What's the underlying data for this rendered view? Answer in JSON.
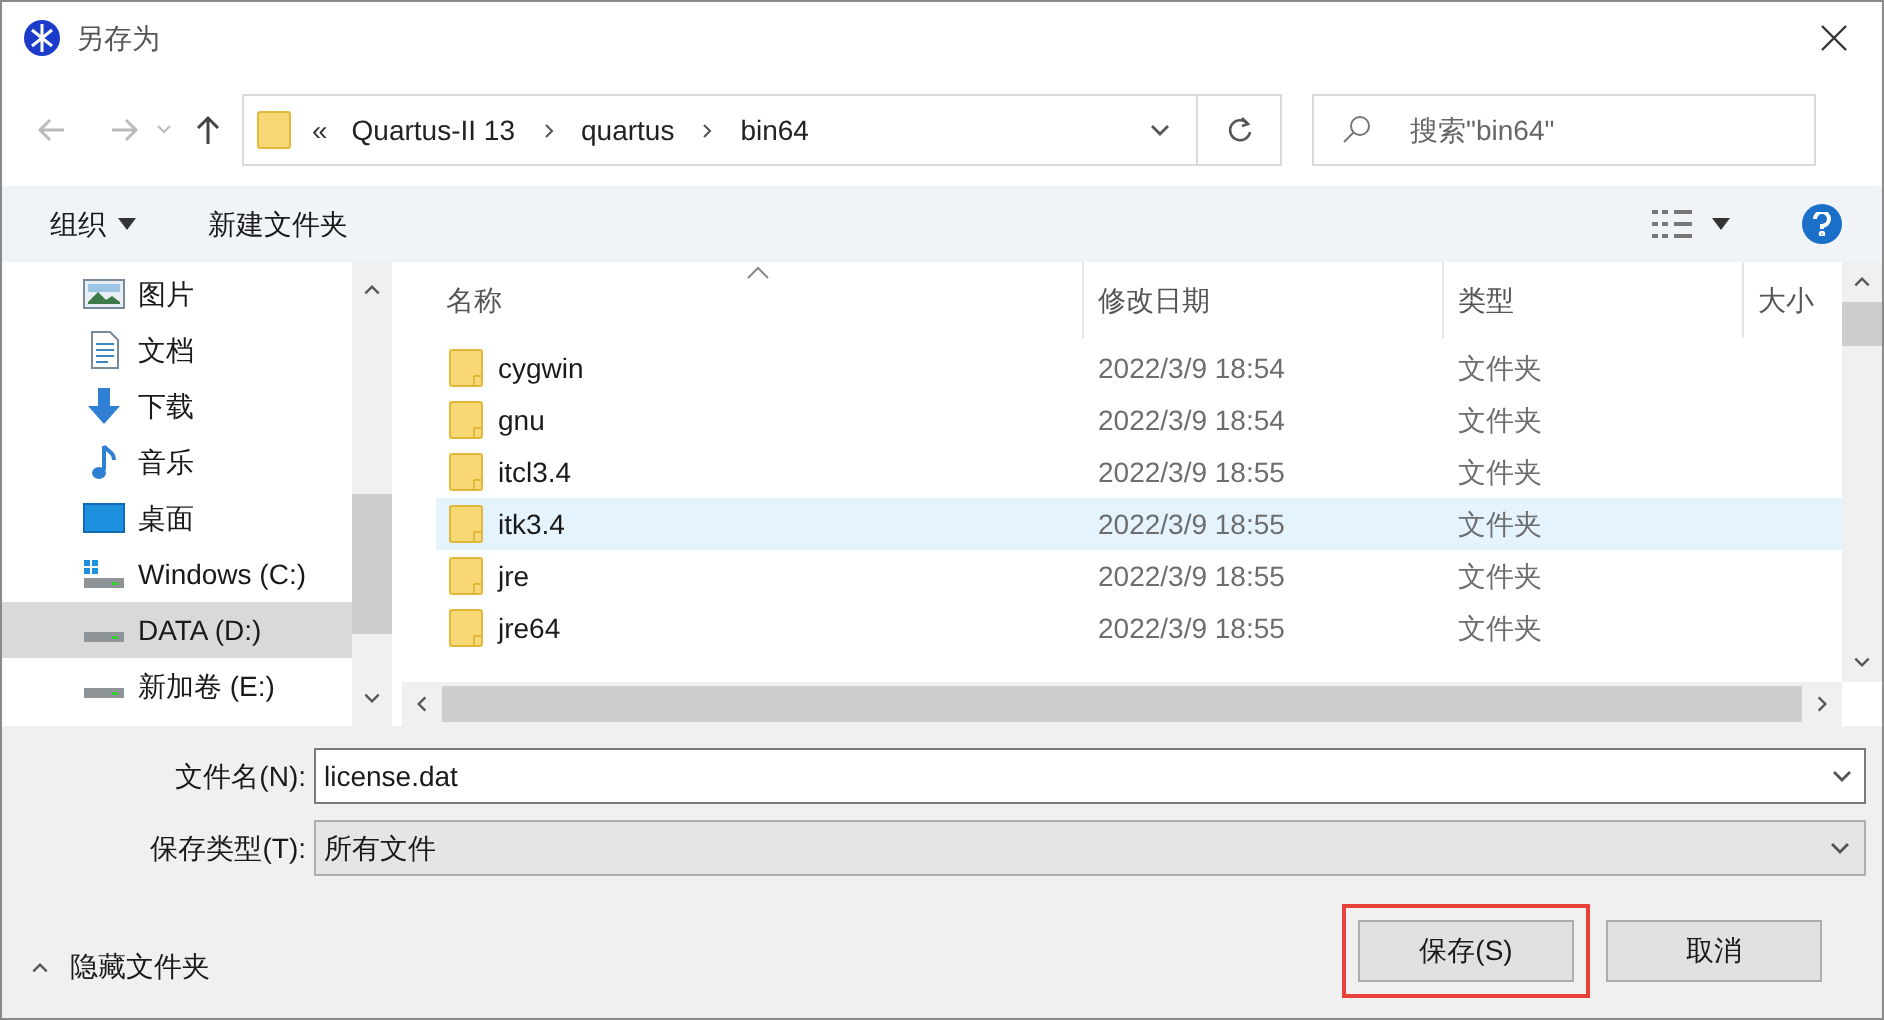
{
  "window": {
    "title": "另存为"
  },
  "address_bar": {
    "overflow": "«",
    "segments": [
      "Quartus-II 13",
      "quartus",
      "bin64"
    ]
  },
  "search": {
    "placeholder": "搜索\"bin64\""
  },
  "toolbar": {
    "organize": "组织",
    "new_folder": "新建文件夹"
  },
  "sidebar": {
    "items": [
      {
        "label": "图片",
        "kind": "pictures",
        "selected": false
      },
      {
        "label": "文档",
        "kind": "documents",
        "selected": false
      },
      {
        "label": "下载",
        "kind": "downloads",
        "selected": false
      },
      {
        "label": "音乐",
        "kind": "music",
        "selected": false
      },
      {
        "label": "桌面",
        "kind": "desktop",
        "selected": false
      },
      {
        "label": "Windows (C:)",
        "kind": "system-drive",
        "selected": false
      },
      {
        "label": "DATA (D:)",
        "kind": "drive",
        "selected": true
      },
      {
        "label": "新加卷 (E:)",
        "kind": "drive",
        "selected": false
      }
    ]
  },
  "table": {
    "columns": [
      "名称",
      "修改日期",
      "类型",
      "大小"
    ],
    "rows": [
      {
        "name": "cygwin",
        "date": "2022/3/9 18:54",
        "type": "文件夹",
        "selected": false
      },
      {
        "name": "gnu",
        "date": "2022/3/9 18:54",
        "type": "文件夹",
        "selected": false
      },
      {
        "name": "itcl3.4",
        "date": "2022/3/9 18:55",
        "type": "文件夹",
        "selected": false
      },
      {
        "name": "itk3.4",
        "date": "2022/3/9 18:55",
        "type": "文件夹",
        "selected": true
      },
      {
        "name": "jre",
        "date": "2022/3/9 18:55",
        "type": "文件夹",
        "selected": false
      },
      {
        "name": "jre64",
        "date": "2022/3/9 18:55",
        "type": "文件夹",
        "selected": false
      }
    ]
  },
  "filename": {
    "label": "文件名(N):",
    "value": "license.dat"
  },
  "filetype": {
    "label": "保存类型(T):",
    "value": "所有文件"
  },
  "hide_folders": "隐藏文件夹",
  "buttons": [
    {
      "label": "保存(S)",
      "highlighted": true
    },
    {
      "label": "取消",
      "highlighted": false
    }
  ]
}
